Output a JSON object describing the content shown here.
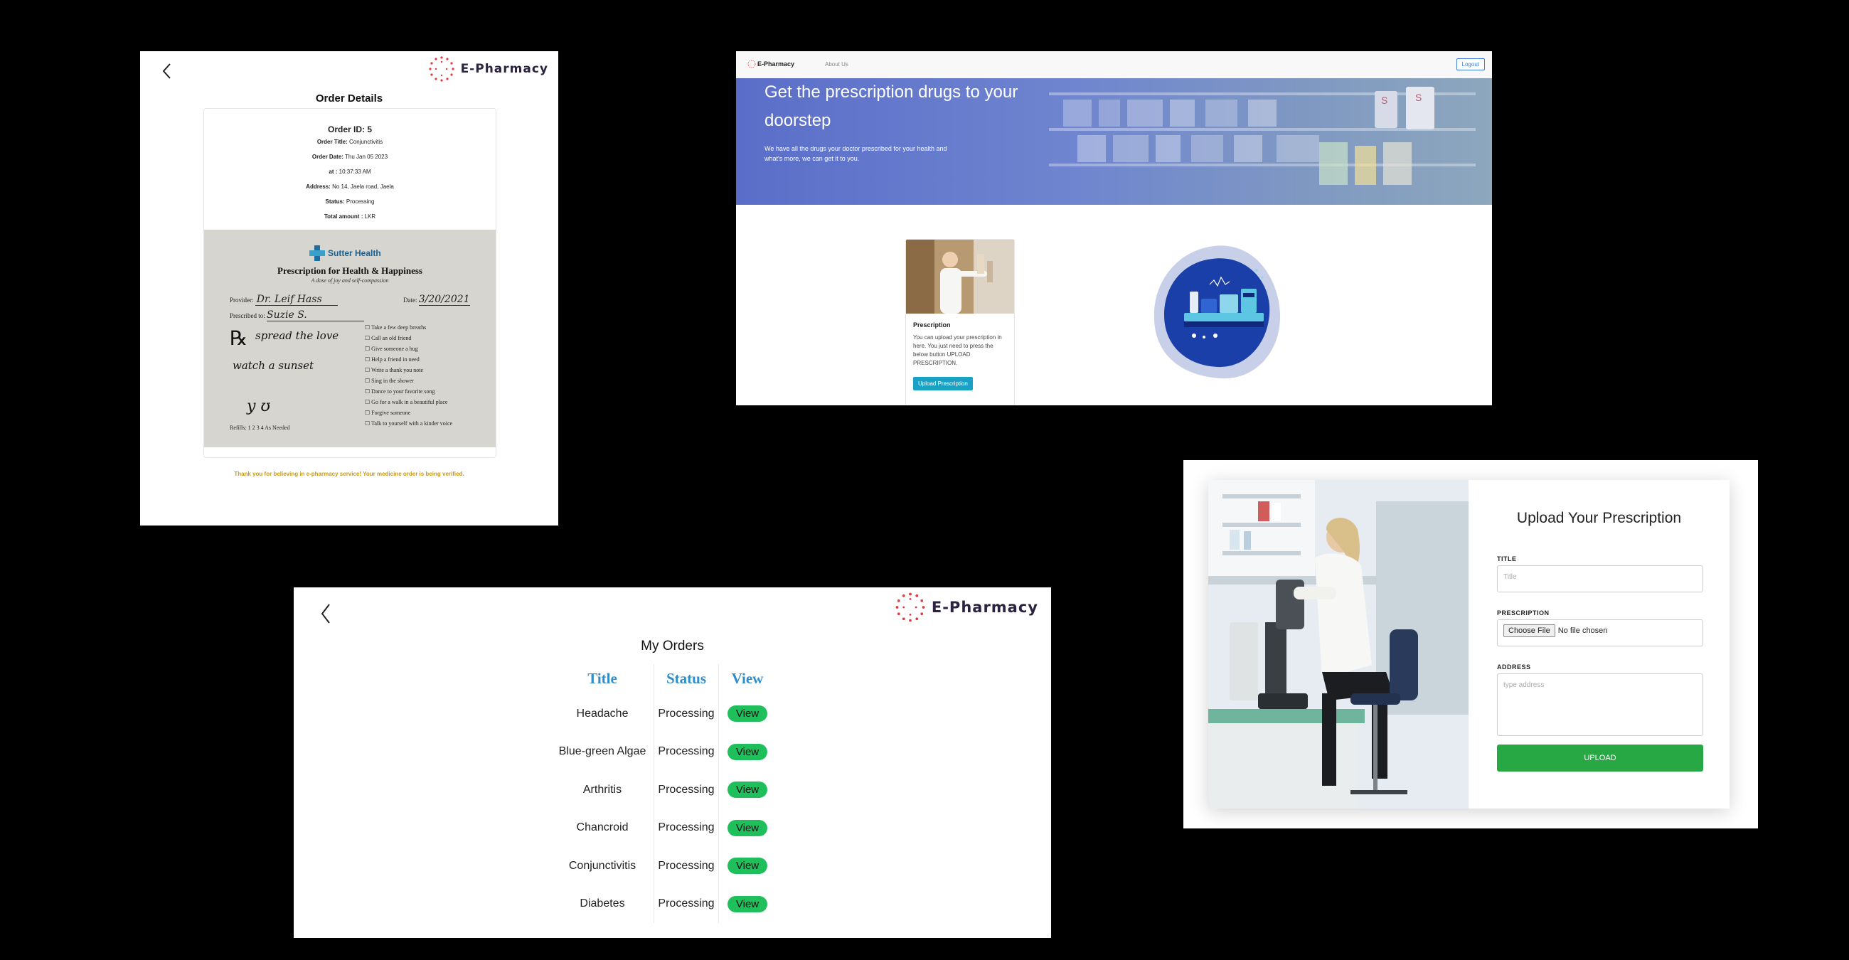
{
  "brand": {
    "name": "E-Pharmacy"
  },
  "order_details": {
    "title": "Order Details",
    "order_id": "Order ID: 5",
    "order_title_label": "Order Title:",
    "order_title_value": "Conjunctivitis",
    "order_date_label": "Order Date:",
    "order_date_value": "Thu Jan 05 2023",
    "at_label": "at :",
    "at_value": "10:37:33 AM",
    "address_label": "Address:",
    "address_value": "No 14, Jaela road, Jaela",
    "status_label": "Status:",
    "status_value": "Processing",
    "total_label": "Total amount :",
    "total_value": "LKR",
    "prescription": {
      "org": "Sutter Health",
      "heading": "Prescription for Health & Happiness",
      "subheading": "A dose of joy and self-compassion",
      "provider_label": "Provider:",
      "provider_value": "Dr. Leif Hass",
      "date_label": "Date:",
      "date_value": "3/20/2021",
      "prescribed_label": "Prescribed to:",
      "prescribed_value": "Suzie S.",
      "rx_line_1": "spread the love",
      "rx_line_2": "watch a sunset",
      "refills_label": "Refills:",
      "refills_values": "1  2  3  4  As Needed",
      "checklist": [
        "Take a few deep breaths",
        "Call an old friend",
        "Give someone a hug",
        "Help a friend in need",
        "Write a thank you note",
        "Sing in the shower",
        "Dance to your favorite song",
        "Go for a walk in a beautiful place",
        "Forgive someone",
        "Talk to yourself with a kinder voice"
      ]
    },
    "thanks": "Thank you for believing in e-pharmacy service! Your medicine order is being verified."
  },
  "landing": {
    "nav_brand": "E-Pharmacy",
    "nav_about": "About Us",
    "logout": "Logout",
    "hero_title": "Get the prescription drugs to your doorstep",
    "hero_text": "We have all the drugs your doctor prescribed for your health and what's more, we can get it to you.",
    "card_title": "Prescription",
    "card_text": "You can upload your prescription in here. You just need to press the below button UPLOAD PRESCRIPTION.",
    "card_button": "Upload Prescription"
  },
  "upload": {
    "title": "Upload Your Prescription",
    "title_label": "TITLE",
    "title_placeholder": "Title",
    "prescription_label": "PRESCRIPTION",
    "choose_file": "Choose File",
    "no_file": "No file chosen",
    "address_label": "ADDRESS",
    "address_placeholder": "type address",
    "upload_button": "UPLOAD"
  },
  "orders": {
    "title": "My Orders",
    "columns": [
      "Title",
      "Status",
      "View"
    ],
    "rows": [
      {
        "title": "Headache",
        "status": "Processing",
        "view": "View"
      },
      {
        "title": "Blue-green Algae",
        "status": "Processing",
        "view": "View"
      },
      {
        "title": "Arthritis",
        "status": "Processing",
        "view": "View"
      },
      {
        "title": "Chancroid",
        "status": "Processing",
        "view": "View"
      },
      {
        "title": "Conjunctivitis",
        "status": "Processing",
        "view": "View"
      },
      {
        "title": "Diabetes",
        "status": "Processing",
        "view": "View"
      }
    ]
  }
}
